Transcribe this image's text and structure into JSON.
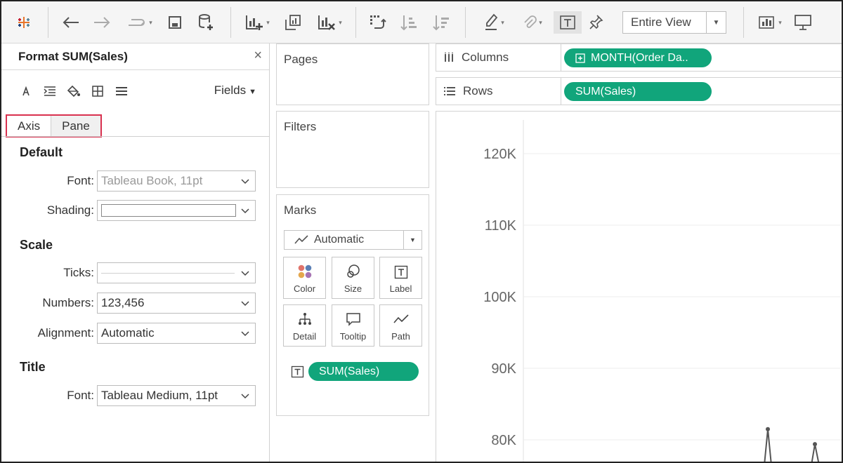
{
  "toolbar": {
    "icons": [
      "tableau-logo-icon",
      "back-icon",
      "forward-icon",
      "redo-icon",
      "save-icon",
      "new-datasource-icon",
      "new-worksheet-icon",
      "duplicate-icon",
      "clear-sheet-icon",
      "swap-icon",
      "sort-ascending-icon",
      "sort-descending-icon",
      "highlight-icon",
      "group-icon",
      "show-labels-icon",
      "pin-icon",
      "show-me-icon",
      "presentation-icon"
    ],
    "view_select": "Entire View"
  },
  "format_panel": {
    "title": "Format SUM(Sales)",
    "close": "×",
    "icon_names": [
      "font-icon",
      "alignment-icon",
      "shading-icon",
      "borders-icon",
      "lines-icon"
    ],
    "fields_label": "Fields",
    "tabs": [
      "Axis",
      "Pane"
    ],
    "sections": {
      "default": {
        "title": "Default",
        "font_label": "Font:",
        "font_value": "Tableau Book, 11pt",
        "shading_label": "Shading:"
      },
      "scale": {
        "title": "Scale",
        "ticks_label": "Ticks:",
        "numbers_label": "Numbers:",
        "numbers_value": "123,456",
        "alignment_label": "Alignment:",
        "alignment_value": "Automatic"
      },
      "title": {
        "title": "Title",
        "font_label": "Font:",
        "font_value": "Tableau Medium, 11pt"
      }
    }
  },
  "shelves": {
    "pages": "Pages",
    "filters": "Filters",
    "marks": {
      "title": "Marks",
      "type": "Automatic",
      "cards": [
        {
          "label": "Color",
          "icon": "color-dots-icon"
        },
        {
          "label": "Size",
          "icon": "size-circles-icon"
        },
        {
          "label": "Label",
          "icon": "label-text-icon"
        },
        {
          "label": "Detail",
          "icon": "detail-tree-icon"
        },
        {
          "label": "Tooltip",
          "icon": "tooltip-bubble-icon"
        },
        {
          "label": "Path",
          "icon": "path-line-icon"
        }
      ],
      "pill": "SUM(Sales)"
    },
    "columns": {
      "label": "Columns",
      "pill": "MONTH(Order Da.."
    },
    "rows": {
      "label": "Rows",
      "pill": "SUM(Sales)"
    }
  },
  "chart_data": {
    "type": "line",
    "y_ticks": [
      "120K",
      "110K",
      "100K",
      "90K",
      "80K"
    ],
    "ylim_visible": [
      78000,
      120000
    ],
    "grid": true,
    "points_visible": [
      {
        "label": "peak-1",
        "y": 81500
      },
      {
        "label": "peak-2",
        "y": 79400
      }
    ]
  },
  "colors": {
    "pill_green": "#11a57b",
    "tab_highlight": "#d9314f"
  }
}
